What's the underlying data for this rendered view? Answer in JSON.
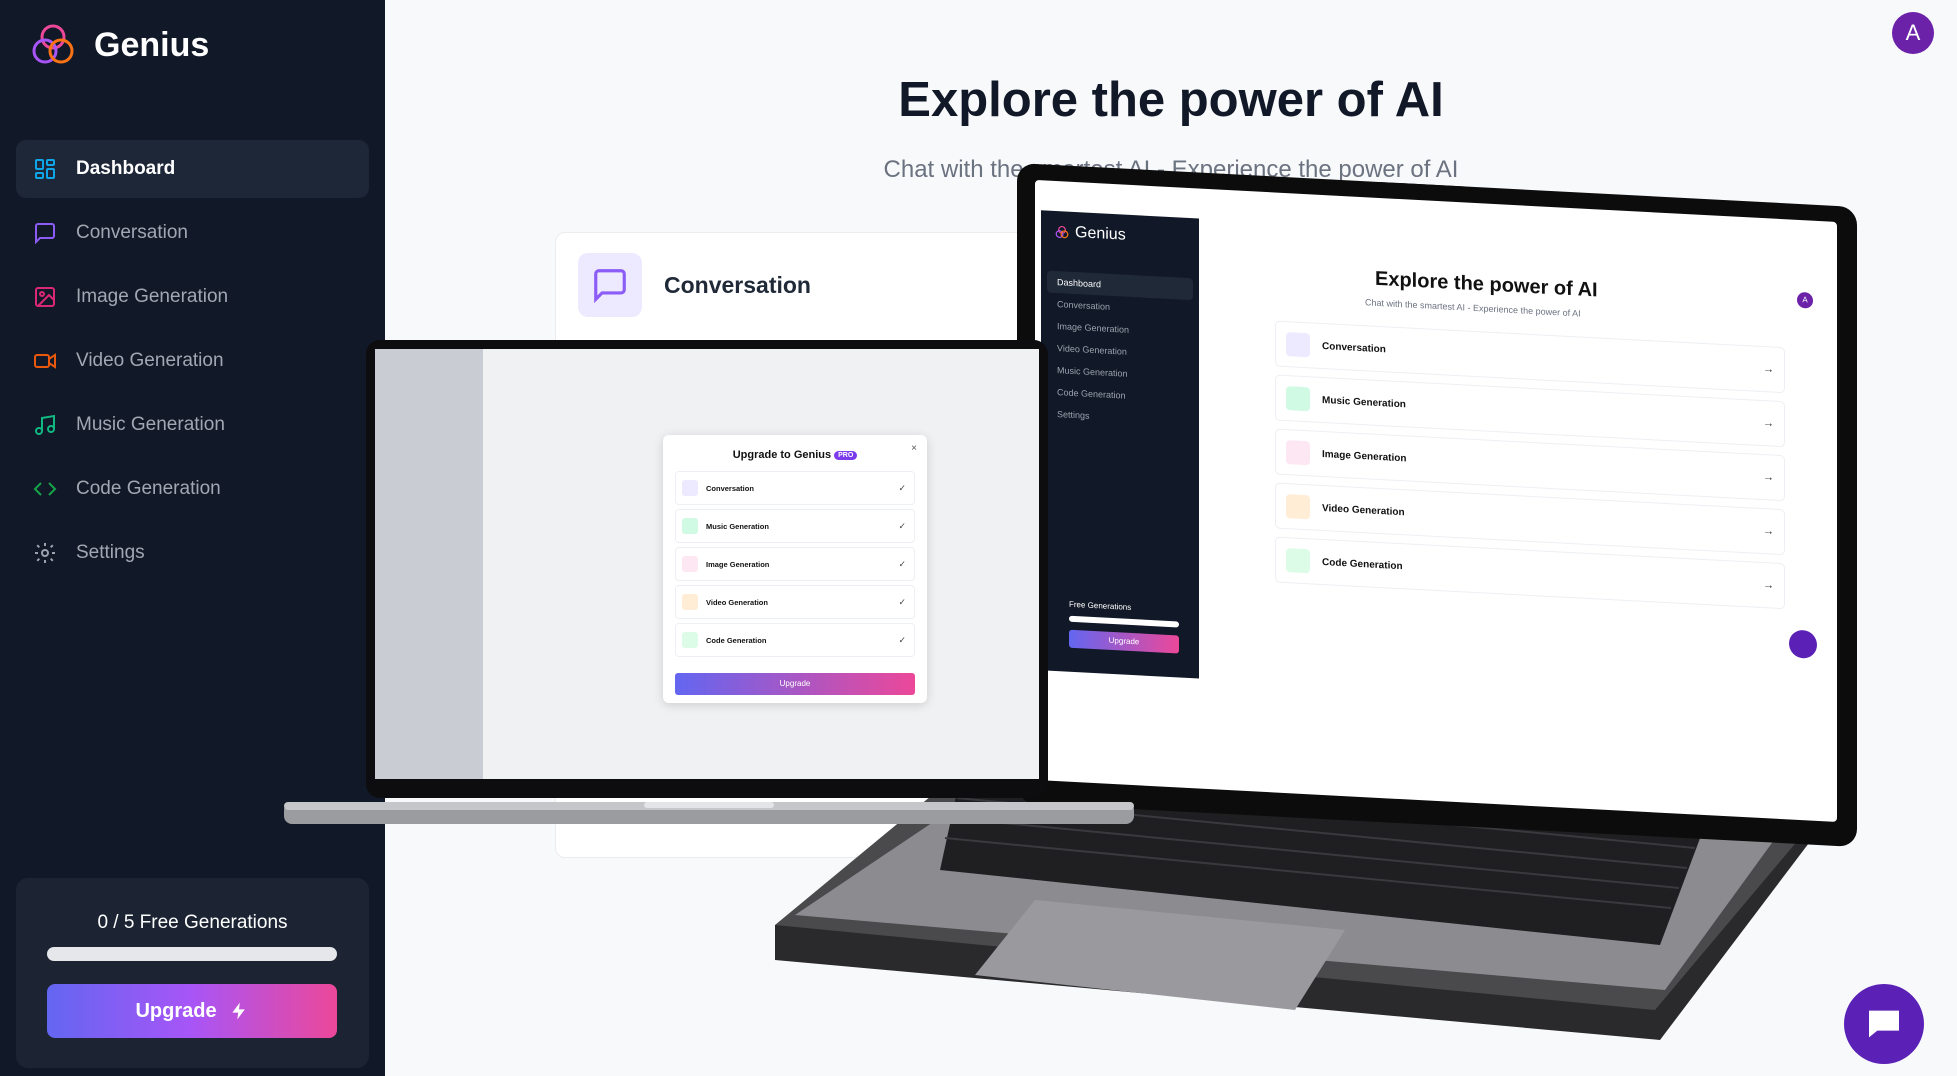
{
  "app": {
    "name": "Genius"
  },
  "sidebar": {
    "items": [
      {
        "label": "Dashboard",
        "icon": "layout-dashboard-icon",
        "color": "#0ea5e9",
        "active": true
      },
      {
        "label": "Conversation",
        "icon": "message-square-icon",
        "color": "#8b5cf6"
      },
      {
        "label": "Image Generation",
        "icon": "image-icon",
        "color": "#db2777"
      },
      {
        "label": "Video Generation",
        "icon": "video-icon",
        "color": "#ea580c"
      },
      {
        "label": "Music Generation",
        "icon": "music-icon",
        "color": "#10b981"
      },
      {
        "label": "Code Generation",
        "icon": "code-icon",
        "color": "#16a34a"
      },
      {
        "label": "Settings",
        "icon": "settings-icon",
        "color": "#9ca3af"
      }
    ],
    "free_counter": {
      "text": "0 / 5 Free Generations",
      "used": 0,
      "limit": 5
    },
    "upgrade_label": "Upgrade"
  },
  "header": {
    "avatar_letter": "A"
  },
  "hero": {
    "title": "Explore the power of AI",
    "subtitle": "Chat with the smartest AI - Experience the power of AI"
  },
  "tools": [
    {
      "label": "Conversation",
      "icon": "message-square-icon",
      "color": "#8b5cf6"
    }
  ],
  "mockup_big": {
    "brand": "Genius",
    "nav": [
      "Dashboard",
      "Conversation",
      "Image Generation",
      "Video Generation",
      "Music Generation",
      "Code Generation",
      "Settings"
    ],
    "title": "Explore the power of AI",
    "subtitle": "Chat with the smartest AI - Experience the power of AI",
    "avatar": "A",
    "rows": [
      "Conversation",
      "Music Generation",
      "Image Generation",
      "Video Generation",
      "Code Generation"
    ],
    "free_text": "Free Generations",
    "upgrade": "Upgrade"
  },
  "mockup_small": {
    "modal_title": "Upgrade to Genius",
    "pro_badge": "PRO",
    "rows": [
      "Conversation",
      "Music Generation",
      "Image Generation",
      "Video Generation",
      "Code Generation"
    ],
    "upgrade": "Upgrade"
  },
  "colors": {
    "sidebar_bg": "#111827",
    "accent": "#8b5cf6",
    "upgrade_from": "#6366f1",
    "upgrade_to": "#ec4899"
  }
}
